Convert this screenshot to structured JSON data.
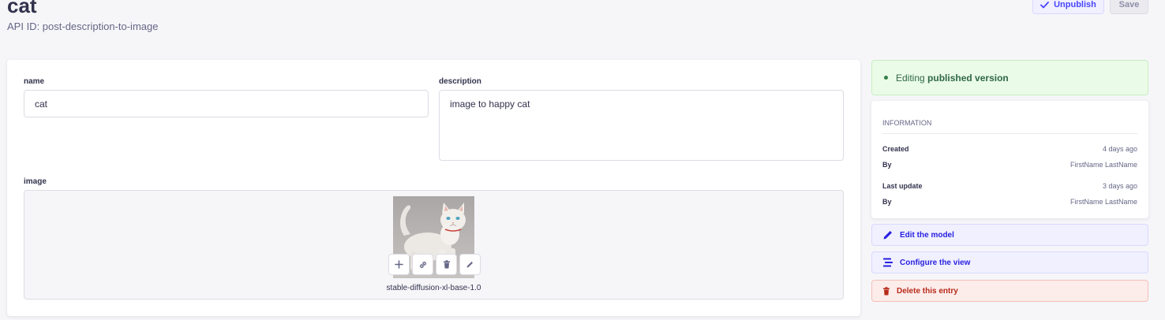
{
  "header": {
    "title": "cat",
    "api_id": "API ID: post-description-to-image",
    "unpublish_label": "Unpublish",
    "save_label": "Save"
  },
  "form": {
    "name": {
      "label": "name",
      "value": "cat"
    },
    "description": {
      "label": "description",
      "value": "image to happy cat"
    },
    "image": {
      "label": "image",
      "caption": "stable-diffusion-xl-base-1.0"
    }
  },
  "status": {
    "prefix": "Editing",
    "strong": "published version"
  },
  "information": {
    "heading": "INFORMATION",
    "rows": [
      {
        "key": "Created",
        "value": "4 days ago"
      },
      {
        "key": "By",
        "value": "FirstName LastName"
      },
      {
        "key": "Last update",
        "value": "3 days ago"
      },
      {
        "key": "By",
        "value": "FirstName LastName"
      }
    ]
  },
  "actions": {
    "edit_model": "Edit the model",
    "configure_view": "Configure the view",
    "delete_entry": "Delete this entry"
  },
  "icons": {
    "check": "check-icon",
    "plus": "plus-icon",
    "link": "link-icon",
    "trash": "trash-icon",
    "pencil": "pencil-icon",
    "layout": "layout-icon"
  },
  "colors": {
    "primary": "#4945ff",
    "success_bg": "#eafbe7",
    "danger": "#b72b1a"
  }
}
